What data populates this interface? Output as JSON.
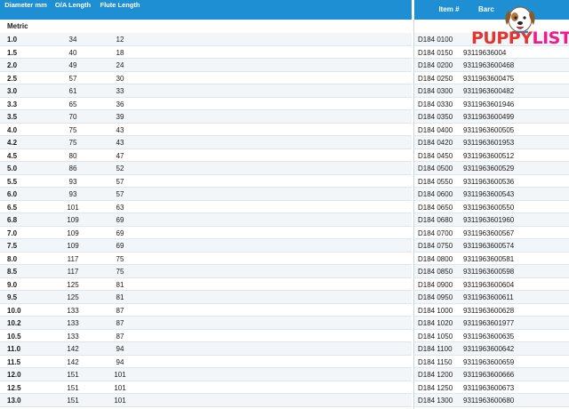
{
  "header": {
    "diameter": "Diameter mm",
    "oa_length": "O/A Length",
    "flute_length": "Flute Length",
    "item": "Item #",
    "barcode": "Barc"
  },
  "section": {
    "label": "Metric"
  },
  "rows": [
    {
      "dia": "1.0",
      "oa": "34",
      "flute": "12",
      "item": "D184 0100",
      "barcode": ""
    },
    {
      "dia": "1.5",
      "oa": "40",
      "flute": "18",
      "item": "D184 0150",
      "barcode": "93119636004"
    },
    {
      "dia": "2.0",
      "oa": "49",
      "flute": "24",
      "item": "D184 0200",
      "barcode": "9311963600468"
    },
    {
      "dia": "2.5",
      "oa": "57",
      "flute": "30",
      "item": "D184 0250",
      "barcode": "9311963600475"
    },
    {
      "dia": "3.0",
      "oa": "61",
      "flute": "33",
      "item": "D184 0300",
      "barcode": "9311963600482"
    },
    {
      "dia": "3.3",
      "oa": "65",
      "flute": "36",
      "item": "D184 0330",
      "barcode": "9311963601946"
    },
    {
      "dia": "3.5",
      "oa": "70",
      "flute": "39",
      "item": "D184 0350",
      "barcode": "9311963600499"
    },
    {
      "dia": "4.0",
      "oa": "75",
      "flute": "43",
      "item": "D184 0400",
      "barcode": "9311963600505"
    },
    {
      "dia": "4.2",
      "oa": "75",
      "flute": "43",
      "item": "D184 0420",
      "barcode": "9311963601953"
    },
    {
      "dia": "4.5",
      "oa": "80",
      "flute": "47",
      "item": "D184 0450",
      "barcode": "9311963600512"
    },
    {
      "dia": "5.0",
      "oa": "86",
      "flute": "52",
      "item": "D184 0500",
      "barcode": "9311963600529"
    },
    {
      "dia": "5.5",
      "oa": "93",
      "flute": "57",
      "item": "D184 0550",
      "barcode": "9311963600536"
    },
    {
      "dia": "6.0",
      "oa": "93",
      "flute": "57",
      "item": "D184 0600",
      "barcode": "9311963600543"
    },
    {
      "dia": "6.5",
      "oa": "101",
      "flute": "63",
      "item": "D184 0650",
      "barcode": "9311963600550"
    },
    {
      "dia": "6.8",
      "oa": "109",
      "flute": "69",
      "item": "D184 0680",
      "barcode": "9311963601960"
    },
    {
      "dia": "7.0",
      "oa": "109",
      "flute": "69",
      "item": "D184 0700",
      "barcode": "9311963600567"
    },
    {
      "dia": "7.5",
      "oa": "109",
      "flute": "69",
      "item": "D184 0750",
      "barcode": "9311963600574"
    },
    {
      "dia": "8.0",
      "oa": "117",
      "flute": "75",
      "item": "D184 0800",
      "barcode": "9311963600581"
    },
    {
      "dia": "8.5",
      "oa": "117",
      "flute": "75",
      "item": "D184 0850",
      "barcode": "9311963600598"
    },
    {
      "dia": "9.0",
      "oa": "125",
      "flute": "81",
      "item": "D184 0900",
      "barcode": "9311963600604"
    },
    {
      "dia": "9.5",
      "oa": "125",
      "flute": "81",
      "item": "D184 0950",
      "barcode": "9311963600611"
    },
    {
      "dia": "10.0",
      "oa": "133",
      "flute": "87",
      "item": "D184 1000",
      "barcode": "9311963600628"
    },
    {
      "dia": "10.2",
      "oa": "133",
      "flute": "87",
      "item": "D184 1020",
      "barcode": "9311963601977"
    },
    {
      "dia": "10.5",
      "oa": "133",
      "flute": "87",
      "item": "D184 1050",
      "barcode": "9311963600635"
    },
    {
      "dia": "11.0",
      "oa": "142",
      "flute": "94",
      "item": "D184 1100",
      "barcode": "9311963600642"
    },
    {
      "dia": "11.5",
      "oa": "142",
      "flute": "94",
      "item": "D184 1150",
      "barcode": "9311963600659"
    },
    {
      "dia": "12.0",
      "oa": "151",
      "flute": "101",
      "item": "D184 1200",
      "barcode": "9311963600666"
    },
    {
      "dia": "12.5",
      "oa": "151",
      "flute": "101",
      "item": "D184 1250",
      "barcode": "9311963600673"
    },
    {
      "dia": "13.0",
      "oa": "151",
      "flute": "101",
      "item": "D184 1300",
      "barcode": "9311963600680"
    }
  ],
  "logo": {
    "part1": "PUPPY",
    "part2": "LIST",
    "icon": "dog-icon"
  },
  "colors": {
    "header_bg": "#1f8fd3",
    "row_alt": "#f3f6f9",
    "logo_red": "#e3342f",
    "logo_orange": "#f5a623",
    "logo_pink": "#e91e8c"
  }
}
